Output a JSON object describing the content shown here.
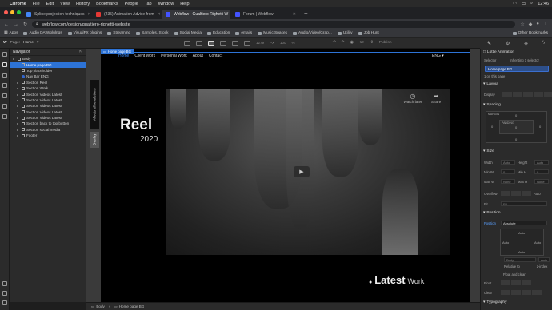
{
  "menubar": {
    "app": "Chrome",
    "items": [
      "File",
      "Edit",
      "View",
      "History",
      "Bookmarks",
      "People",
      "Tab",
      "Window",
      "Help"
    ],
    "clock": "12:46"
  },
  "tabs": [
    {
      "title": "Spline projection techniques",
      "color": "#4285f4",
      "active": false
    },
    {
      "title": "(235) Animation Advice from",
      "color": "#e53935",
      "active": false
    },
    {
      "title": "Webflow - Gualtiero Righetti W",
      "color": "#4353ff",
      "active": true
    },
    {
      "title": "Forum | Webflow",
      "color": "#4353ff",
      "active": false
    }
  ],
  "address": {
    "url": "webflow.com/design/gualtiero-righetti-website"
  },
  "bookmarks": {
    "items": [
      "Apps",
      "Audio DAW/plulngs",
      "VisualFX plugins",
      "Streaming",
      "Samples, Stock",
      "Social Media",
      "Education",
      "emails",
      "Music Spaces",
      "Audio/Video/Grap...",
      "Utility",
      "Job Hunt"
    ],
    "other": "Other Bookmarks"
  },
  "toolbar": {
    "page_label": "Page:",
    "page_name": "Home",
    "width_readout": "1279",
    "zoom_readout": "100",
    "zoom_unit": "%",
    "publish": "Publish"
  },
  "navigator": {
    "title": "Navigator",
    "items": [
      {
        "label": "Body",
        "level": 0,
        "selected": false
      },
      {
        "label": "Home page BG",
        "level": 1,
        "selected": true
      },
      {
        "label": "Top placeholder",
        "level": 1,
        "selected": false
      },
      {
        "label": "Nav Bar ENG",
        "level": 1,
        "selected": false
      },
      {
        "label": "Section Reel",
        "level": 1,
        "selected": false
      },
      {
        "label": "Section Work",
        "level": 1,
        "selected": false
      },
      {
        "label": "Section Videos Latest",
        "level": 1,
        "selected": false
      },
      {
        "label": "Section Videos Latest",
        "level": 1,
        "selected": false
      },
      {
        "label": "Section Videos Latest",
        "level": 1,
        "selected": false
      },
      {
        "label": "Section Videos Latest",
        "level": 1,
        "selected": false
      },
      {
        "label": "Section Videos Latest",
        "level": 1,
        "selected": false
      },
      {
        "label": "Section back to top button",
        "level": 1,
        "selected": false
      },
      {
        "label": "Section social media",
        "level": 1,
        "selected": false
      },
      {
        "label": "Footer",
        "level": 1,
        "selected": false
      }
    ]
  },
  "canvas": {
    "badge": "Home page BG",
    "nav_links": [
      "Home",
      "Client Work",
      "Personal Work",
      "About",
      "Contact"
    ],
    "lang": "ENG",
    "side_tab": "Affects all resolutions",
    "side_tab2": "Overlay",
    "video_watch_later": "Watch later",
    "video_share": "Share",
    "reel_title": "Reel",
    "reel_year": "2020",
    "latest_bold": "Latest",
    "latest_light": "Work"
  },
  "breadcrumbs": [
    "Body",
    "Home page BG"
  ],
  "right_panel": {
    "tabs": [
      "brush-icon",
      "gear-icon",
      "drop-icon",
      "bolt-icon"
    ],
    "lottie": "Lottie Animation",
    "selector_label": "Selector",
    "inheriting": "Inheriting 1 selector",
    "selector_value": "Home page BG",
    "on_page": "1 on this page",
    "layout": "Layout",
    "display": "Display",
    "spacing": "Spacing",
    "margin_label": "MARGIN",
    "padding_label": "PADDING",
    "zero": "0",
    "size": "Size",
    "width": "Width",
    "height": "Height",
    "minw": "Min W",
    "minh": "Min H",
    "maxw": "Max W",
    "maxh": "Max H",
    "auto": "Auto",
    "none": "None",
    "overflow": "Overflow",
    "fit": "Fit",
    "fit_value": "Fill",
    "position": "Position",
    "position_label": "Position",
    "position_value": "Absolute",
    "relative_to": "Body",
    "relative_note": "Relative to",
    "z_index": "z-index",
    "float_clear": "Float and clear",
    "float": "Float",
    "clear": "Clear",
    "typography": "Typography"
  }
}
